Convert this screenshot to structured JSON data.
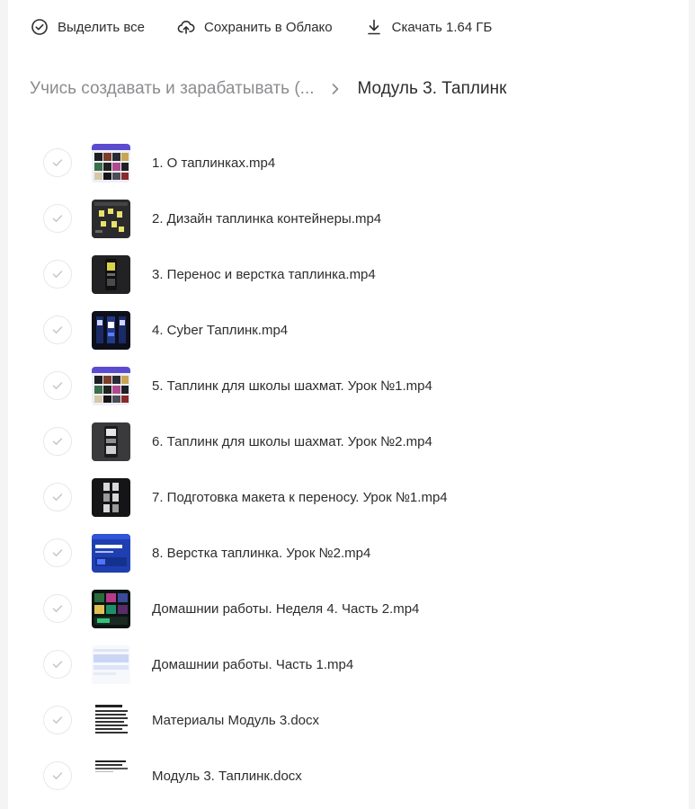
{
  "toolbar": {
    "select_all": "Выделить все",
    "save_cloud": "Сохранить в Облако",
    "download": "Скачать 1.64 ГБ"
  },
  "breadcrumb": {
    "parent": "Учись создавать и зарабатывать (...",
    "current": "Модуль 3. Таплинк"
  },
  "files": [
    {
      "name": "1. О таплинках.mp4",
      "thumb": "collage-purple"
    },
    {
      "name": "2. Дизайн таплинка контейнеры.mp4",
      "thumb": "dark-stickers"
    },
    {
      "name": "3. Перенос и верстка таплинка.mp4",
      "thumb": "dark-phone-yellow"
    },
    {
      "name": "4. Cyber Таплинк.mp4",
      "thumb": "dark-cards-blue"
    },
    {
      "name": "5. Таплинк для школы шахмат. Урок №1.mp4",
      "thumb": "collage-purple"
    },
    {
      "name": "6. Таплинк для школы шахмат. Урок №2.mp4",
      "thumb": "gray-phone"
    },
    {
      "name": "7. Подготовка макета к переносу. Урок №1.mp4",
      "thumb": "dark-grid"
    },
    {
      "name": "8. Верстка таплинка. Урок №2.mp4",
      "thumb": "blue-page"
    },
    {
      "name": "Домашнии работы. Неделя 4. Часть 2.mp4",
      "thumb": "dark-green-grid"
    },
    {
      "name": "Домашнии работы. Часть 1.mp4",
      "thumb": "light-blue-page"
    },
    {
      "name": "Материалы Модуль 3.docx",
      "thumb": "doc-lines"
    },
    {
      "name": "Модуль 3. Таплинк.docx",
      "thumb": "doc-short"
    }
  ]
}
